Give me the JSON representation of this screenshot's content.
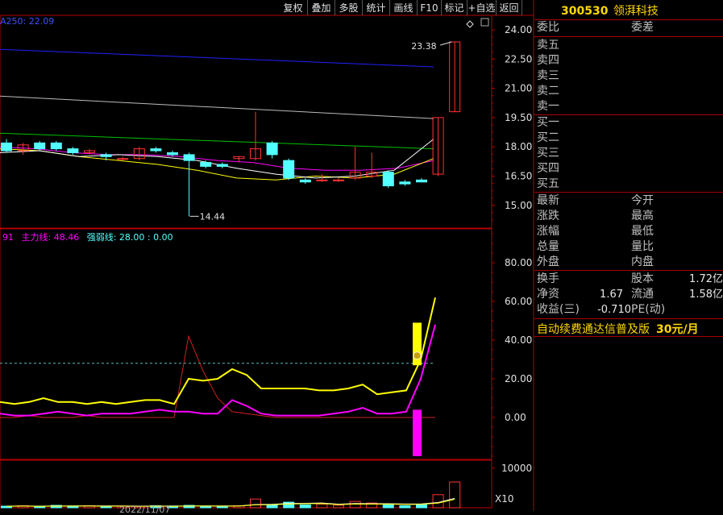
{
  "toolbar": {
    "items": [
      "复权",
      "叠加",
      "多股",
      "统计",
      "画线",
      "F10",
      "标记",
      "+自选",
      "返回"
    ]
  },
  "indicator_ma": {
    "text": "A250: 22.09"
  },
  "indicator_osc": {
    "prefix": "91",
    "main_line": "主力线: 48.46",
    "strength_line": "强弱线: 28.00 : 0.00"
  },
  "volume_multiplier": "X10",
  "bottom_date_fragment": "2022/11/07",
  "stock": {
    "code": "300530",
    "name": "领湃科技"
  },
  "quote": {
    "weibi": "委比",
    "weicha": "委差",
    "sell_levels": [
      "卖五",
      "卖四",
      "卖三",
      "卖二",
      "卖一"
    ],
    "buy_levels": [
      "买一",
      "买二",
      "买三",
      "买四",
      "买五"
    ],
    "stats_left": [
      "最新",
      "涨跌",
      "涨幅",
      "总量",
      "外盘"
    ],
    "stats_right": [
      "今开",
      "最高",
      "最低",
      "量比",
      "内盘"
    ],
    "turnover_label": "换手",
    "share_capital_label": "股本",
    "share_capital_value": "1.72亿",
    "net_assets_label": "净资",
    "net_assets_value": "1.67",
    "float_label": "流通",
    "float_value": "1.58亿",
    "eps_label": "收益(三)",
    "eps_value": "-0.710",
    "pe_label": "PE(动)"
  },
  "promo": {
    "text": "自动续费通达信普及版",
    "price": "30元/月"
  },
  "colors": {
    "up": "#ff3232",
    "down": "#54ffff",
    "axis": "#b40000",
    "ma_white": "#ffffff",
    "ma_yellow": "#ffff00",
    "ma_magenta": "#ff00ff",
    "ma_green": "#00c000",
    "ma_gray": "#bbbbbb",
    "ma_blue": "#2020ff"
  },
  "chart_data": {
    "type": "candlestick",
    "price_axis": {
      "ticks": [
        "24.00",
        "22.50",
        "21.00",
        "19.50",
        "18.00",
        "16.50",
        "15.00"
      ],
      "range": [
        14.0,
        24.5
      ]
    },
    "annotations": {
      "high_label": "23.38",
      "low_label": "14.44"
    },
    "candles": [
      {
        "o": 18.2,
        "c": 17.8,
        "h": 18.4,
        "l": 17.7
      },
      {
        "o": 17.8,
        "c": 18.1,
        "h": 18.2,
        "l": 17.6
      },
      {
        "o": 18.2,
        "c": 17.9,
        "h": 18.3,
        "l": 17.8
      },
      {
        "o": 18.2,
        "c": 17.9,
        "h": 18.3,
        "l": 17.8
      },
      {
        "o": 17.9,
        "c": 17.7,
        "h": 18.0,
        "l": 17.6
      },
      {
        "o": 17.7,
        "c": 17.8,
        "h": 17.9,
        "l": 17.6
      },
      {
        "o": 17.6,
        "c": 17.5,
        "h": 17.7,
        "l": 17.3
      },
      {
        "o": 17.4,
        "c": 17.4,
        "h": 17.5,
        "l": 17.3
      },
      {
        "o": 17.4,
        "c": 17.9,
        "h": 18.0,
        "l": 17.3
      },
      {
        "o": 17.9,
        "c": 17.8,
        "h": 18.0,
        "l": 17.7
      },
      {
        "o": 17.7,
        "c": 17.6,
        "h": 17.8,
        "l": 17.5
      },
      {
        "o": 17.6,
        "c": 17.3,
        "h": 17.7,
        "l": 14.44
      },
      {
        "o": 17.2,
        "c": 17.0,
        "h": 17.3,
        "l": 16.9
      },
      {
        "o": 17.1,
        "c": 17.0,
        "h": 17.2,
        "l": 16.9
      },
      {
        "o": 17.4,
        "c": 17.5,
        "h": 17.5,
        "l": 17.2
      },
      {
        "o": 17.4,
        "c": 17.9,
        "h": 19.8,
        "l": 17.3
      },
      {
        "o": 18.2,
        "c": 17.6,
        "h": 18.3,
        "l": 17.4
      },
      {
        "o": 17.3,
        "c": 16.4,
        "h": 17.4,
        "l": 16.3
      },
      {
        "o": 16.3,
        "c": 16.2,
        "h": 16.4,
        "l": 16.1
      },
      {
        "o": 16.3,
        "c": 16.3,
        "h": 16.6,
        "l": 16.2
      },
      {
        "o": 16.3,
        "c": 16.3,
        "h": 16.4,
        "l": 16.2
      },
      {
        "o": 16.4,
        "c": 16.7,
        "h": 18.0,
        "l": 16.3
      },
      {
        "o": 16.5,
        "c": 16.7,
        "h": 17.7,
        "l": 16.4
      },
      {
        "o": 16.7,
        "c": 16.0,
        "h": 16.8,
        "l": 15.9
      },
      {
        "o": 16.2,
        "c": 16.1,
        "h": 16.3,
        "l": 16.0
      },
      {
        "o": 16.3,
        "c": 16.2,
        "h": 16.4,
        "l": 16.2
      },
      {
        "o": 16.6,
        "c": 19.5,
        "h": 19.5,
        "l": 16.5
      },
      {
        "o": 19.8,
        "c": 23.38,
        "h": 23.38,
        "l": 19.8
      }
    ],
    "moving_averages": [
      {
        "color": "#2020ff",
        "values": [
          23.0,
          22.1
        ]
      },
      {
        "color": "#bbbbbb",
        "values": [
          20.6,
          19.45
        ]
      },
      {
        "color": "#00c000",
        "values": [
          18.7,
          17.9
        ]
      },
      {
        "color": "#ff00ff",
        "values": [
          18.0,
          17.9,
          17.7,
          17.6,
          17.6,
          17.5,
          17.3,
          17.2,
          16.9,
          16.8,
          16.8,
          16.9,
          17.3
        ]
      },
      {
        "color": "#ffff00",
        "values": [
          17.9,
          17.8,
          17.5,
          17.3,
          17.1,
          16.8,
          16.4,
          16.3,
          16.5,
          16.4,
          16.6,
          17.4
        ]
      },
      {
        "color": "#ffffff",
        "values": [
          17.7,
          17.8,
          17.5,
          17.6,
          17.5,
          17.3,
          16.9,
          16.6,
          16.4,
          16.5,
          16.8,
          18.4
        ]
      }
    ],
    "oscillator": {
      "axis_ticks": [
        "80.00",
        "60.00",
        "40.00",
        "20.00",
        "0.00"
      ],
      "range": [
        -25,
        100
      ],
      "main_line": [
        8,
        7,
        8,
        10,
        8,
        8,
        7,
        8,
        7,
        8,
        9,
        9,
        7,
        20,
        19,
        20,
        25,
        22,
        15,
        15,
        15,
        15,
        14,
        14,
        15,
        17,
        12,
        13,
        14,
        30,
        62
      ],
      "strength_line": [
        2,
        1,
        1,
        2,
        3,
        2,
        1,
        2,
        2,
        2,
        3,
        4,
        3,
        3,
        2,
        2,
        9,
        6,
        2,
        1,
        1,
        1,
        1,
        2,
        3,
        5,
        2,
        2,
        3,
        20,
        48
      ],
      "red_line": [
        0,
        0,
        1,
        0,
        0,
        0,
        1,
        0,
        0,
        0,
        0,
        0,
        0,
        42,
        24,
        10,
        3,
        2,
        1,
        0,
        0,
        0,
        0,
        0,
        0,
        0,
        0,
        0,
        0,
        0,
        0
      ],
      "reference_level": 28,
      "last_bar_high": 49,
      "last_bar_low": 27,
      "negative_bar": -20
    },
    "volume": {
      "axis_ticks": [
        "10000"
      ],
      "range": [
        0,
        12000
      ],
      "values": [
        400,
        500,
        350,
        600,
        450,
        500,
        300,
        420,
        380,
        500,
        450,
        600,
        400,
        350,
        500,
        2200,
        800,
        1400,
        700,
        900,
        650,
        1600,
        1200,
        700,
        500,
        900,
        3300,
        6500
      ]
    }
  }
}
